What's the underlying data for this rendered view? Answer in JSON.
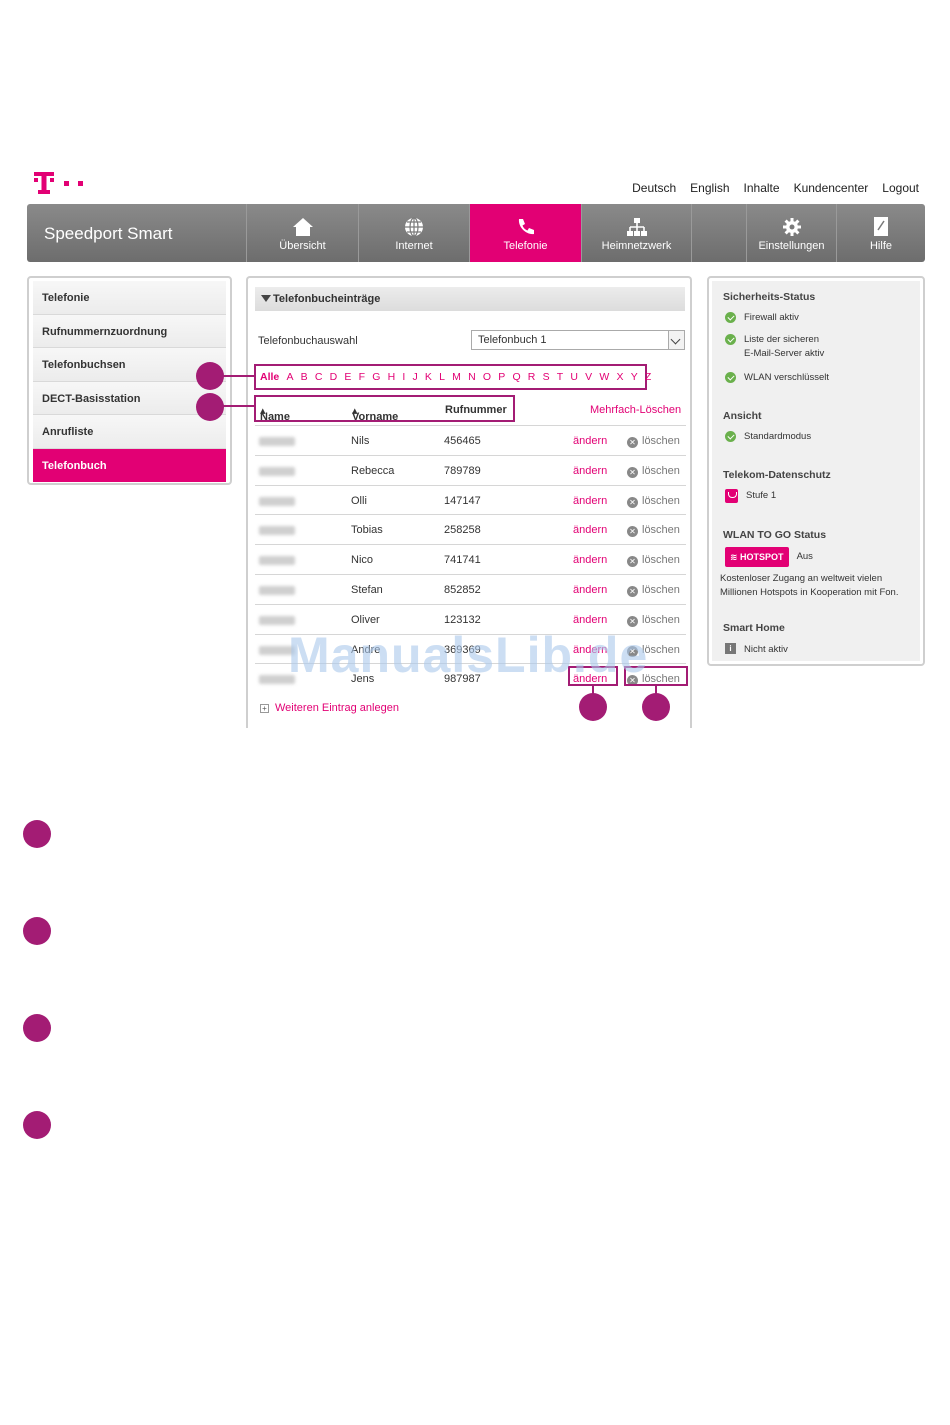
{
  "toplinks": [
    "Deutsch",
    "English",
    "Inhalte",
    "Kundencenter",
    "Logout"
  ],
  "brand": "Speedport Smart",
  "nav": [
    {
      "label": "Übersicht",
      "icon": "home-icon"
    },
    {
      "label": "Internet",
      "icon": "globe-icon"
    },
    {
      "label": "Telefonie",
      "icon": "phone-icon",
      "active": true
    },
    {
      "label": "Heimnetzwerk",
      "icon": "network-icon"
    },
    {
      "label": "",
      "icon": ""
    },
    {
      "label": "Einstellungen",
      "icon": "gear-icon"
    },
    {
      "label": "Hilfe",
      "icon": "help-book-icon"
    }
  ],
  "sidebar": [
    "Telefonie",
    "Rufnummernzuordnung",
    "Telefonbuchsen",
    "DECT-Basisstation",
    "Anrufliste",
    "Telefonbuch"
  ],
  "main": {
    "header": "Telefonbucheinträge",
    "select_label": "Telefonbuchauswahl",
    "select_value": "Telefonbuch 1",
    "letters": [
      "Alle",
      "A",
      "B",
      "C",
      "D",
      "E",
      "F",
      "G",
      "H",
      "I",
      "J",
      "K",
      "L",
      "M",
      "N",
      "O",
      "P",
      "Q",
      "R",
      "S",
      "T",
      "U",
      "V",
      "W",
      "X",
      "Y",
      "Z"
    ],
    "columns": {
      "name": "Name",
      "vorname": "Vorname",
      "nummer": "Rufnummer"
    },
    "multi_delete": "Mehrfach-Löschen",
    "edit_label": "ändern",
    "delete_label": "löschen",
    "rows": [
      {
        "vorname": "Nils",
        "nummer": "456465"
      },
      {
        "vorname": "Rebecca",
        "nummer": "789789"
      },
      {
        "vorname": "Olli",
        "nummer": "147147"
      },
      {
        "vorname": "Tobias",
        "nummer": "258258"
      },
      {
        "vorname": "Nico",
        "nummer": "741741"
      },
      {
        "vorname": "Stefan",
        "nummer": "852852"
      },
      {
        "vorname": "Oliver",
        "nummer": "123132"
      },
      {
        "vorname": "Andre",
        "nummer": "369369"
      },
      {
        "vorname": "Jens",
        "nummer": "987987"
      }
    ],
    "add_entry": "Weiteren Eintrag anlegen"
  },
  "status": {
    "sicherheit_title": "Sicherheits-Status",
    "firewall": "Firewall aktiv",
    "mailserver_1": "Liste der sicheren",
    "mailserver_2": "E-Mail-Server aktiv",
    "wlan": "WLAN verschlüsselt",
    "ansicht_title": "Ansicht",
    "ansicht": "Standardmodus",
    "datenschutz_title": "Telekom-Datenschutz",
    "stufe": "Stufe 1",
    "wlantogo_title": "WLAN TO GO Status",
    "hotspot": "HOTSPOT",
    "hotspot_state": "Aus",
    "hotspot_desc_1": "Kostenloser Zugang an weltweit vielen",
    "hotspot_desc_2": "Millionen Hotspots in Kooperation mit Fon.",
    "smarthome_title": "Smart Home",
    "smarthome": "Nicht aktiv"
  },
  "watermark": "ManualsLib.de",
  "colors": {
    "magenta": "#e20074",
    "marker": "#a31c74",
    "nav_gray": "#7a7a7a"
  }
}
